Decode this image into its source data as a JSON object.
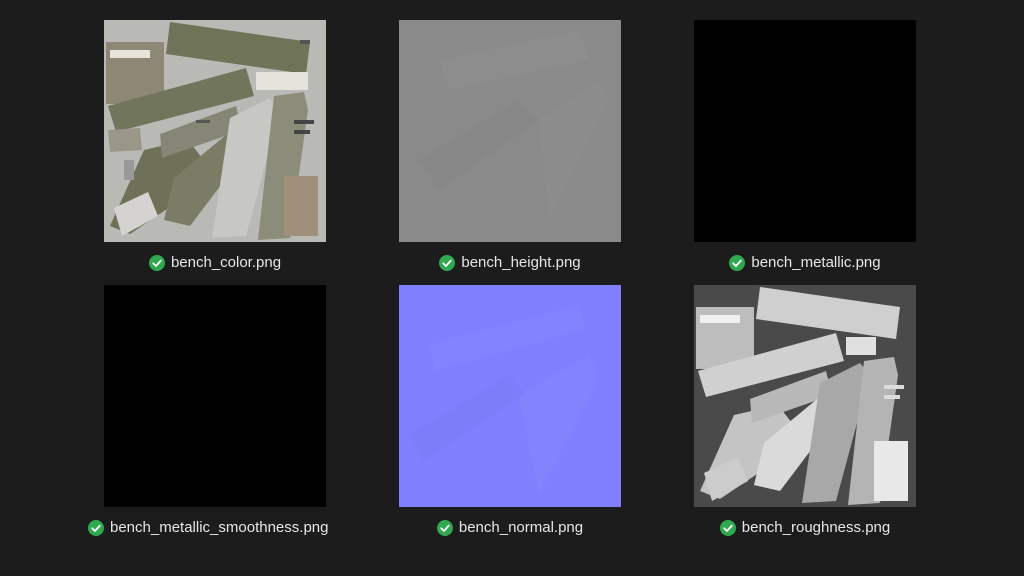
{
  "files": [
    {
      "name": "bench_color.png",
      "status": "synced-check-icon"
    },
    {
      "name": "bench_height.png",
      "status": "synced-check-icon"
    },
    {
      "name": "bench_metallic.png",
      "status": "synced-check-icon"
    },
    {
      "name": "bench_metallic_smoothness.png",
      "status": "synced-check-icon"
    },
    {
      "name": "bench_normal.png",
      "status": "synced-check-icon"
    },
    {
      "name": "bench_roughness.png",
      "status": "synced-check-icon"
    }
  ],
  "colors": {
    "background": "#1c1c1c",
    "check": "#2fa84f",
    "height_map": "#8a8a8a",
    "normal_map": "#8080ff",
    "metallic_map": "#000000"
  }
}
